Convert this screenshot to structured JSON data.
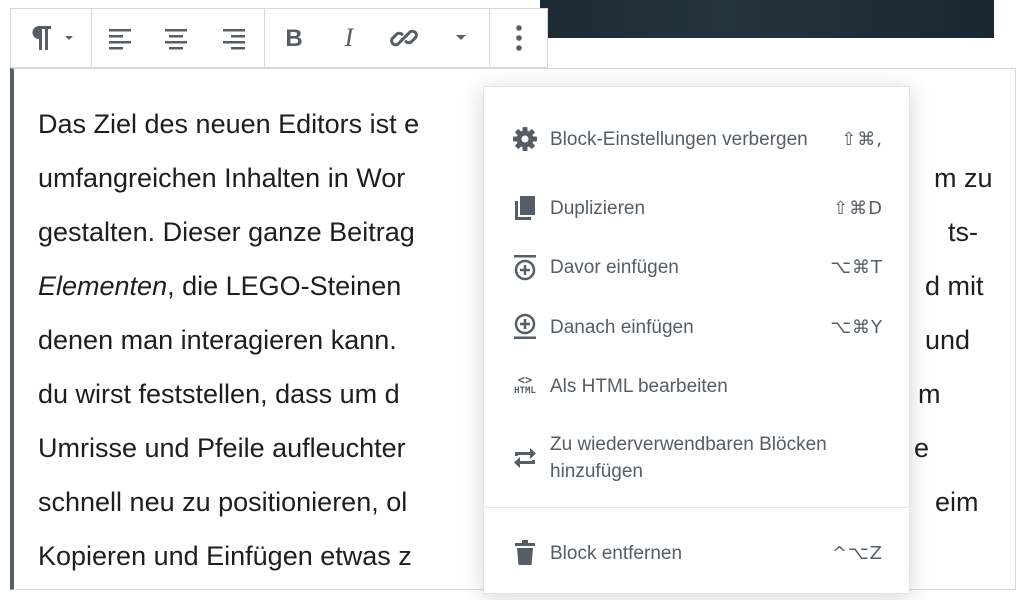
{
  "toolbar": {
    "paragraph_icon": "paragraph-icon",
    "align": [
      "align-left-icon",
      "align-center-icon",
      "align-right-icon"
    ],
    "format": [
      "bold-icon",
      "italic-icon",
      "link-icon",
      "chevron-down-icon"
    ],
    "more": "more-vertical-icon"
  },
  "paragraph": {
    "line1": "Das Ziel des neuen Editors ist e",
    "line2a": "umfangreichen Inhalten in Wor",
    "line2b": "m zu",
    "line3a": "gestalten. Dieser ganze Beitrag",
    "line3b": "ts-",
    "line4_em": "Elementen",
    "line4a": ", die LEGO-Steinen",
    "line4b": "d mit",
    "line5a": "denen man interagieren kann.",
    "line5b": "und",
    "line6a": "du wirst feststellen, dass um d",
    "line6b": "m",
    "line7a": "Umrisse und Pfeile aufleuchter",
    "line7b": "e",
    "line8a": "schnell neu zu positionieren, ol",
    "line8b": "eim",
    "line9a": "Kopieren und Einfügen etwas z"
  },
  "menu": {
    "items": [
      {
        "icon": "gear-icon",
        "label": "Block-Einstellungen verbergen",
        "shortcut": "⇧⌘,"
      },
      {
        "icon": "duplicate-icon",
        "label": "Duplizieren",
        "shortcut": "⇧⌘D"
      },
      {
        "icon": "insert-before-icon",
        "label": "Davor einfügen",
        "shortcut": "⌥⌘T"
      },
      {
        "icon": "insert-after-icon",
        "label": "Danach einfügen",
        "shortcut": "⌥⌘Y"
      },
      {
        "icon": "html-icon",
        "label": "Als HTML bearbeiten",
        "shortcut": ""
      },
      {
        "icon": "reusable-icon",
        "label": "Zu wiederverwendbaren Blöcken hinzufügen",
        "shortcut": ""
      },
      {
        "icon": "trash-icon",
        "label": "Block entfernen",
        "shortcut": "^⌥Z"
      }
    ],
    "html_icon_text": "HTML"
  }
}
